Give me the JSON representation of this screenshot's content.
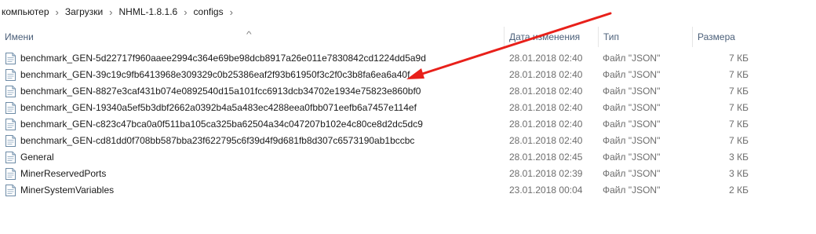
{
  "breadcrumb": [
    "компьютер",
    "Загрузки",
    "NHML-1.8.1.6",
    "configs"
  ],
  "columns": {
    "name": "Имени",
    "date": "Дата изменения",
    "type": "Тип",
    "size": "Размера"
  },
  "files": [
    {
      "name": "benchmark_GEN-5d22717f960aaee2994c364e69be98dcb8917a26e011e7830842cd1224dd5a9d",
      "date": "28.01.2018 02:40",
      "type": "Файл \"JSON\"",
      "size": "7 КБ",
      "icon": "json-file-icon"
    },
    {
      "name": "benchmark_GEN-39c19c9fb6413968e309329c0b25386eaf2f93b61950f3c2f0c3b8fa6ea6a40f",
      "date": "28.01.2018 02:40",
      "type": "Файл \"JSON\"",
      "size": "7 КБ",
      "icon": "json-file-icon"
    },
    {
      "name": "benchmark_GEN-8827e3caf431b074e0892540d15a101fcc6913dcb34702e1934e75823e860bf0",
      "date": "28.01.2018 02:40",
      "type": "Файл \"JSON\"",
      "size": "7 КБ",
      "icon": "json-file-icon"
    },
    {
      "name": "benchmark_GEN-19340a5ef5b3dbf2662a0392b4a5a483ec4288eea0fbb071eefb6a7457e114ef",
      "date": "28.01.2018 02:40",
      "type": "Файл \"JSON\"",
      "size": "7 КБ",
      "icon": "json-file-icon"
    },
    {
      "name": "benchmark_GEN-c823c47bca0a0f511ba105ca325ba62504a34c047207b102e4c80ce8d2dc5dc9",
      "date": "28.01.2018 02:40",
      "type": "Файл \"JSON\"",
      "size": "7 КБ",
      "icon": "json-file-icon"
    },
    {
      "name": "benchmark_GEN-cd81dd0f708bb587bba23f622795c6f39d4f9d681fb8d307c6573190ab1bccbc",
      "date": "28.01.2018 02:40",
      "type": "Файл \"JSON\"",
      "size": "7 КБ",
      "icon": "json-file-icon"
    },
    {
      "name": "General",
      "date": "28.01.2018 02:45",
      "type": "Файл \"JSON\"",
      "size": "3 КБ",
      "icon": "json-file-icon"
    },
    {
      "name": "MinerReservedPorts",
      "date": "28.01.2018 02:39",
      "type": "Файл \"JSON\"",
      "size": "3 КБ",
      "icon": "json-file-icon"
    },
    {
      "name": "MinerSystemVariables",
      "date": "23.01.2018 00:04",
      "type": "Файл \"JSON\"",
      "size": "2 КБ",
      "icon": "json-file-icon"
    }
  ],
  "colors": {
    "header_text": "#4c607a",
    "annotation_arrow": "#e8201a"
  }
}
